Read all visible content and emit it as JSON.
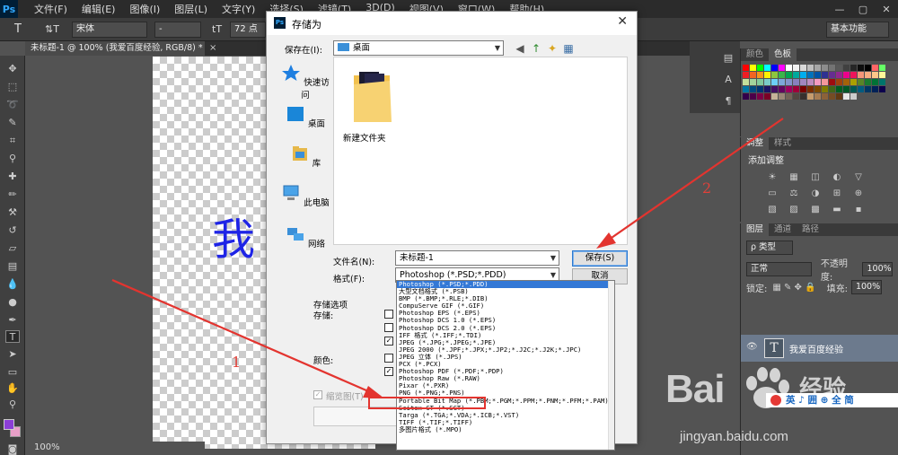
{
  "app": {
    "logo": "Ps",
    "menu": [
      "文件(F)",
      "编辑(E)",
      "图像(I)",
      "图层(L)",
      "文字(Y)",
      "选择(S)",
      "滤镜(T)",
      "3D(D)",
      "视图(V)",
      "窗口(W)",
      "帮助(H)"
    ],
    "window_controls": [
      "—",
      "▢",
      "✕"
    ]
  },
  "options_bar": {
    "tool_glyph": "T",
    "orient_glyph": "⇅T",
    "font_family": "宋体",
    "font_style": "-",
    "size_glyph": "tT",
    "font_size": "72 点",
    "workspace": "基本功能"
  },
  "document": {
    "tab_title": "未标题-1 @ 100% (我爱百度经验, RGB/8) *",
    "tab_close": "×",
    "canvas_text": "我",
    "zoom": "100%"
  },
  "annotations": {
    "label_1": "1",
    "label_2": "2",
    "arrow_color": "#e3342f"
  },
  "right_panels": {
    "swatch_tabs": [
      "颜色",
      "色板"
    ],
    "adjust_tabs": [
      "调整",
      "样式"
    ],
    "adjust_title": "添加调整",
    "layers_tabs": [
      "图层",
      "通道",
      "路径"
    ],
    "layer_filter": "ρ 类型",
    "blend_mode": "正常",
    "opacity_label": "不透明度:",
    "opacity_value": "100%",
    "lock_label": "锁定:",
    "fill_label": "填充:",
    "fill_value": "100%",
    "layer_name": "我爱百度经验",
    "layer_thumb": "T",
    "swatch_colors": [
      "#ff0000",
      "#ffff00",
      "#00ff00",
      "#00ffff",
      "#0000ff",
      "#ff00ff",
      "#ffffff",
      "#f2f2f2",
      "#d9d9d9",
      "#bfbfbf",
      "#a6a6a6",
      "#8c8c8c",
      "#737373",
      "#595959",
      "#404040",
      "#262626",
      "#0d0d0d",
      "#000000",
      "#ff6666",
      "#66ff66",
      "#ee1d24",
      "#f26522",
      "#f7941d",
      "#fff200",
      "#8dc63f",
      "#39b54a",
      "#00a651",
      "#00a99d",
      "#00aeef",
      "#0072bc",
      "#0054a6",
      "#2e3192",
      "#662d91",
      "#92278f",
      "#ec008c",
      "#ed145b",
      "#f69679",
      "#f9ad81",
      "#fdc689",
      "#fff799",
      "#c4df9b",
      "#a3d39c",
      "#82ca9c",
      "#7accc8",
      "#6dcff6",
      "#7da7d9",
      "#8393ca",
      "#8781bd",
      "#a186be",
      "#bd8cbf",
      "#f49ac1",
      "#f5989d",
      "#9e0b0f",
      "#a0410d",
      "#a36209",
      "#aba000",
      "#598527",
      "#1a7b30",
      "#007236",
      "#00746b",
      "#0076a3",
      "#004b80",
      "#003471",
      "#1b1464",
      "#440e62",
      "#630460",
      "#9e005d",
      "#9e0039",
      "#790000",
      "#7b2e00",
      "#7d4900",
      "#827b00",
      "#406618",
      "#005e20",
      "#005826",
      "#005952",
      "#005b7f",
      "#003663",
      "#002157",
      "#0d004c",
      "#32004b",
      "#4b0049",
      "#7b0046",
      "#7a0026",
      "#c7b299",
      "#998675",
      "#736357",
      "#534741",
      "#37302d",
      "#c69c6d",
      "#a67c52",
      "#8c6239",
      "#754c24",
      "#603913",
      "#e6e6e6",
      "#cccccc"
    ],
    "adjust_icons": [
      "☀",
      "▦",
      "◫",
      "◐",
      "▽",
      "▭",
      "⚖",
      "◑",
      "⊞",
      "⊕",
      "▧",
      "▨",
      "▩",
      "▬",
      "▪"
    ]
  },
  "dialog": {
    "title": "存储为",
    "title_icon": "Ps",
    "close": "✕",
    "save_in_label": "保存在(I):",
    "save_in_value": "桌面",
    "nav_icons": [
      "◀",
      "↑",
      "✦",
      "▦"
    ],
    "places": [
      "快速访问",
      "桌面",
      "库",
      "此电脑",
      "网络"
    ],
    "folder_name": "新建文件夹",
    "filename_label": "文件名(N):",
    "filename_value": "未标题-1",
    "format_label": "格式(F):",
    "format_value": "Photoshop (*.PSD;*.PDD)",
    "save_button": "保存(S)",
    "cancel_button": "取消",
    "storage_options_label": "存储选项",
    "storage_label": "存储:",
    "color_label": "颜色:",
    "thumbnail_label": "缩览图(T)",
    "format_options": [
      "Photoshop (*.PSD;*.PDD)",
      "大型文档格式 (*.PSB)",
      "BMP (*.BMP;*.RLE;*.DIB)",
      "CompuServe GIF (*.GIF)",
      "Photoshop EPS (*.EPS)",
      "Photoshop DCS 1.0 (*.EPS)",
      "Photoshop DCS 2.0 (*.EPS)",
      "IFF 格式 (*.IFF;*.TDI)",
      "JPEG (*.JPG;*.JPEG;*.JPE)",
      "JPEG 2000 (*.JPF;*.JPX;*.JP2;*.J2C;*.J2K;*.JPC)",
      "JPEG 立体 (*.JPS)",
      "PCX (*.PCX)",
      "Photoshop PDF (*.PDF;*.PDP)",
      "Photoshop Raw (*.RAW)",
      "Pixar (*.PXR)",
      "PNG (*.PNG;*.PNS)",
      "Portable Bit Map (*.PBM;*.PGM;*.PPM;*.PNM;*.PFM;*.PAM)",
      "Scitex CT (*.SCT)",
      "Targa (*.TGA;*.VDA;*.ICB;*.VST)",
      "TIFF (*.TIF;*.TIFF)",
      "多图片格式 (*.MPO)"
    ]
  },
  "watermark": {
    "logo_left": "Bai",
    "logo_right": "经验",
    "tag": "英 ♪ 囲 ⊕ 全 简",
    "url": "jingyan.baidu.com"
  }
}
